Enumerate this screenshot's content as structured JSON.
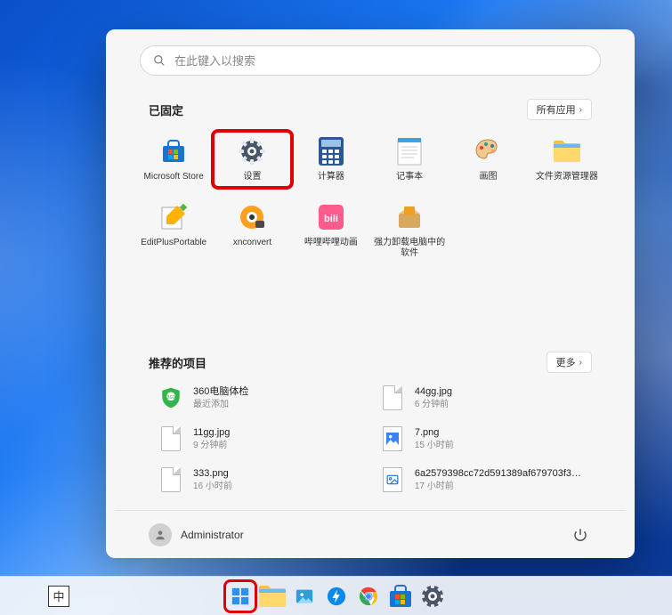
{
  "search": {
    "placeholder": "在此键入以搜索"
  },
  "pinned": {
    "title": "已固定",
    "all_apps_label": "所有应用",
    "apps": [
      {
        "label": "Microsoft Store",
        "icon": "store",
        "highlight": false
      },
      {
        "label": "设置",
        "icon": "settings",
        "highlight": true
      },
      {
        "label": "计算器",
        "icon": "calculator",
        "highlight": false
      },
      {
        "label": "记事本",
        "icon": "notepad",
        "highlight": false
      },
      {
        "label": "画图",
        "icon": "paint",
        "highlight": false
      },
      {
        "label": "文件资源管理器",
        "icon": "explorer",
        "highlight": false
      },
      {
        "label": "EditPlusPortable",
        "icon": "editplus",
        "highlight": false
      },
      {
        "label": "xnconvert",
        "icon": "xnconvert",
        "highlight": false
      },
      {
        "label": "哔哩哔哩动画",
        "icon": "bilibili",
        "highlight": false
      },
      {
        "label": "强力卸载电脑中的软件",
        "icon": "uninstall",
        "highlight": false
      }
    ]
  },
  "recommended": {
    "title": "推荐的项目",
    "more_label": "更多",
    "items": [
      {
        "name": "360电脑体检",
        "sub": "最近添加",
        "thumb": "shield360"
      },
      {
        "name": "44gg.jpg",
        "sub": "6 分钟前",
        "thumb": "doc"
      },
      {
        "name": "11gg.jpg",
        "sub": "9 分钟前",
        "thumb": "doc"
      },
      {
        "name": "7.png",
        "sub": "15 小时前",
        "thumb": "imgblue"
      },
      {
        "name": "333.png",
        "sub": "16 小时前",
        "thumb": "doc"
      },
      {
        "name": "6a2579398cc72d591389af679703f3…",
        "sub": "17 小时前",
        "thumb": "picicon"
      }
    ]
  },
  "footer": {
    "username": "Administrator"
  },
  "taskbar": {
    "ime": "中",
    "icons": [
      {
        "name": "start",
        "highlight": true
      },
      {
        "name": "explorer",
        "highlight": false
      },
      {
        "name": "photos",
        "highlight": false
      },
      {
        "name": "thunder",
        "highlight": false
      },
      {
        "name": "chrome",
        "highlight": false
      },
      {
        "name": "store",
        "highlight": false
      },
      {
        "name": "settings",
        "highlight": false
      }
    ]
  }
}
